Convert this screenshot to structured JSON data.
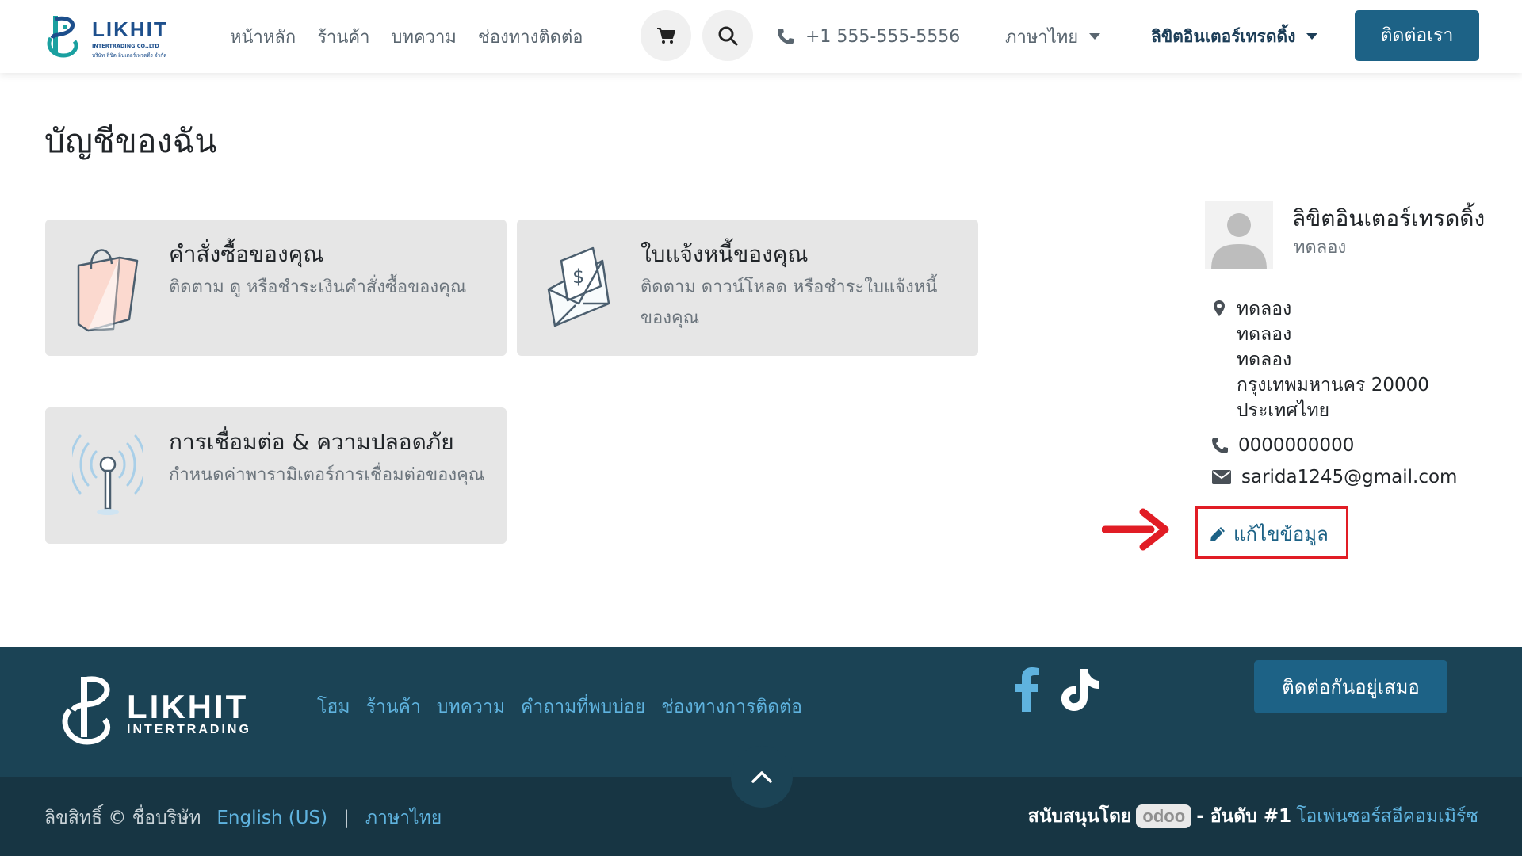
{
  "brand": {
    "logo_name": "LIKHIT",
    "logo_sub": "INTERTRADING CO.,LTD",
    "logo_sub_th": "บริษัท ลิขิต อินเตอร์เทรดดิ้ง จำกัด",
    "accent_color": "#1d6286",
    "footer_color": "#1b4355"
  },
  "header": {
    "nav": [
      "หน้าหลัก",
      "ร้านค้า",
      "บทความ",
      "ช่องทางติดต่อ"
    ],
    "cart_icon": "cart-icon",
    "search_icon": "search-icon",
    "phone": "+1 555-555-5556",
    "language": "ภาษาไทย",
    "user": "ลิขิตอินเตอร์เทรดดิ้ง",
    "contact_button": "ติดต่อเรา"
  },
  "main": {
    "title": "บัญชีของฉัน",
    "cards": [
      {
        "title": "คำสั่งซื้อของคุณ",
        "desc": "ติดตาม ดู หรือชำระเงินคำสั่งซื้อของคุณ",
        "icon": "shopping-bag-icon"
      },
      {
        "title": "ใบแจ้งหนี้ของคุณ",
        "desc": "ติดตาม ดาวน์โหลด หรือชำระใบแจ้งหนี้ของคุณ",
        "icon": "invoice-envelope-icon"
      },
      {
        "title": "การเชื่อมต่อ & ความปลอดภัย",
        "desc": "กำหนดค่าพารามิเตอร์การเชื่อมต่อของคุณ",
        "icon": "antenna-icon"
      }
    ]
  },
  "profile": {
    "name": "ลิขิตอินเตอร์เทรดดิ้ง",
    "subtitle": "ทดลอง",
    "address": [
      "ทดลอง",
      "ทดลอง",
      "ทดลอง",
      "กรุงเทพมหานคร 20000",
      "ประเทศไทย"
    ],
    "phone": "0000000000",
    "email": "sarida1245@gmail.com",
    "edit_label": "แก้ไขข้อมูล"
  },
  "annotation": {
    "highlight_color": "#e11d25"
  },
  "footer": {
    "logo_name": "LIKHIT",
    "logo_sub": "INTERTRADING",
    "nav": [
      "โฮม",
      "ร้านค้า",
      "บทความ",
      "คำถามที่พบบ่อย",
      "ช่องทางการติดต่อ"
    ],
    "social": [
      "facebook-icon",
      "tiktok-icon"
    ],
    "contact_button": "ติดต่อกันอยู่เสมอ",
    "copyright": "ลิขสิทธิ์ © ชื่อบริษัท",
    "lang_en": "English (US)",
    "separator": "|",
    "lang_th": "ภาษาไทย",
    "powered_by": "สนับสนุนโดย",
    "odoo": "odoo",
    "rank": "- อันดับ #1",
    "ecommerce": "โอเพ่นซอร์สอีคอมเมิร์ซ"
  }
}
